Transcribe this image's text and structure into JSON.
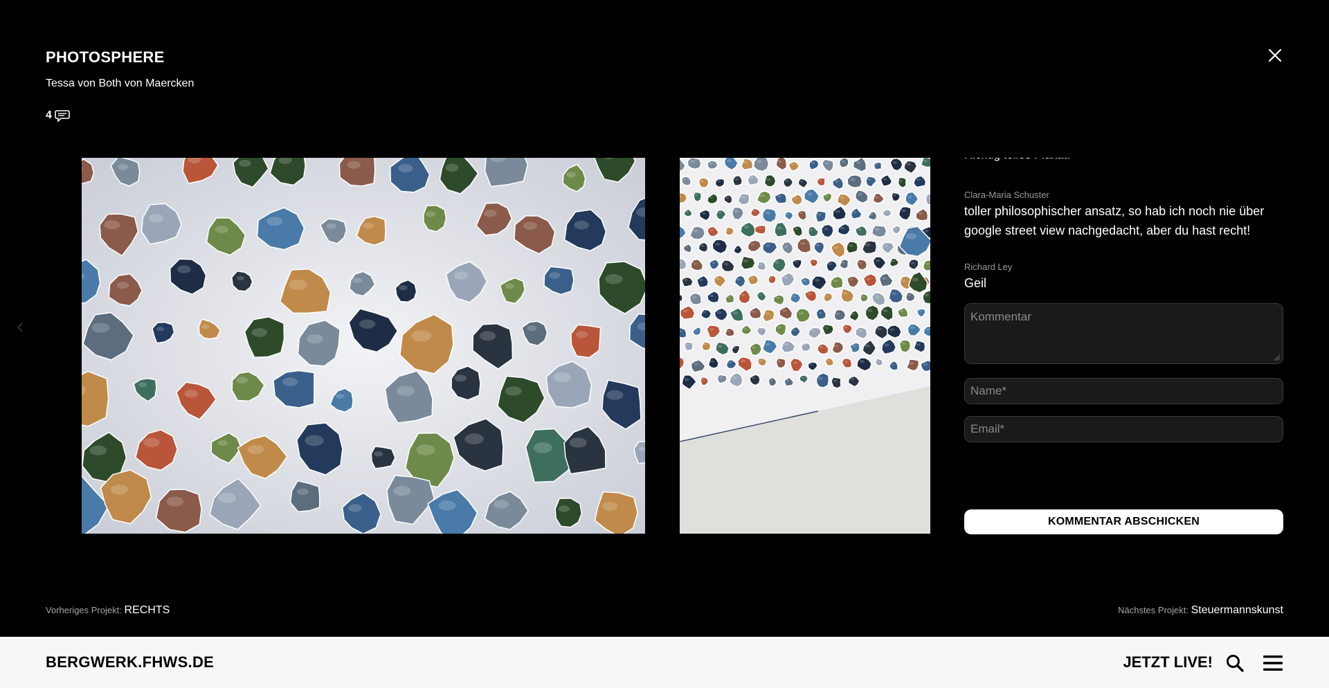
{
  "project": {
    "title": "PHOTOSPHERE",
    "author": "Tessa von Both von Maercken",
    "comment_count": "4"
  },
  "comments": [
    {
      "name": "",
      "text": "Richtig tolles Plakat!"
    },
    {
      "name": "Clara-Maria Schuster",
      "text": "toller philosophischer ansatz, so hab ich noch nie über google street view nachgedacht, aber du hast recht!"
    },
    {
      "name": "Richard Ley",
      "text": "Geil"
    }
  ],
  "form": {
    "comment_placeholder": "Kommentar",
    "name_placeholder": "Name*",
    "email_placeholder": "Email*",
    "submit_label": "KOMMENTAR ABSCHICKEN"
  },
  "navigation": {
    "prev_label": "Vorheriges Projekt:",
    "prev_project": "RECHTS",
    "next_label": "Nächstes Projekt:",
    "next_project": "Steuermannskunst"
  },
  "footer": {
    "brand": "BERGWERK.FHWS.DE",
    "live_label": "JETZT LIVE!"
  },
  "icons": {
    "close": "close-icon",
    "comment": "comment-bubble-icon",
    "search": "search-icon",
    "menu": "hamburger-menu-icon",
    "prev_arrow": "chevron-left-icon"
  },
  "colors": {
    "background": "#000000",
    "footer_bg": "#f7f7f7",
    "field_bg": "#1a1a1a",
    "muted_text": "#9a9a9a"
  }
}
